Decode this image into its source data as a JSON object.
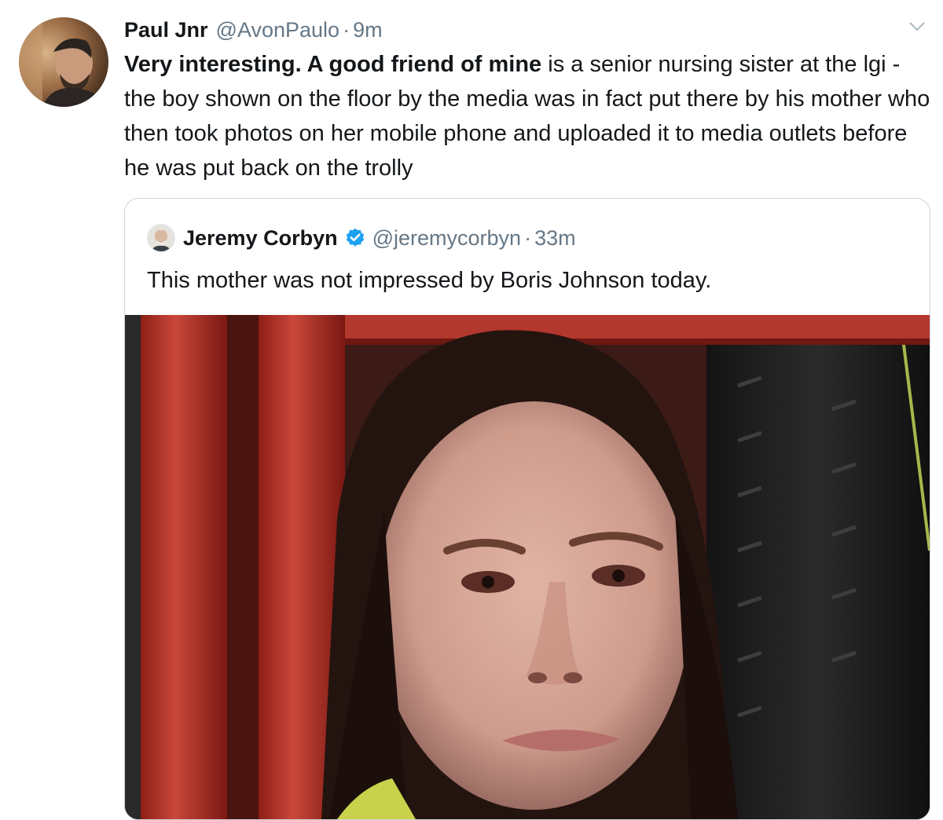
{
  "tweet": {
    "display_name": "Paul Jnr",
    "handle": "@AvonPaulo",
    "separator": "·",
    "time": "9m",
    "text_bold": "Very interesting. A good friend of mine",
    "text_rest": " is a senior nursing sister at the lgi - the boy shown on the floor by the media was in fact put there by his mother who then took photos on her mobile phone and uploaded it to media outlets before he was put back on the trolly",
    "avatar_icon": "user-avatar",
    "menu_icon": "chevron-down-icon"
  },
  "quoted_tweet": {
    "display_name": "Jeremy Corbyn",
    "verified_icon": "verified-badge-icon",
    "handle": "@jeremycorbyn",
    "separator": "·",
    "time": "33m",
    "text": "This mother was not impressed by Boris Johnson today.",
    "media_type": "video-still"
  },
  "colors": {
    "text": "#14171a",
    "secondary": "#657786",
    "border": "#ccd6dd",
    "verified": "#1da1f2"
  }
}
